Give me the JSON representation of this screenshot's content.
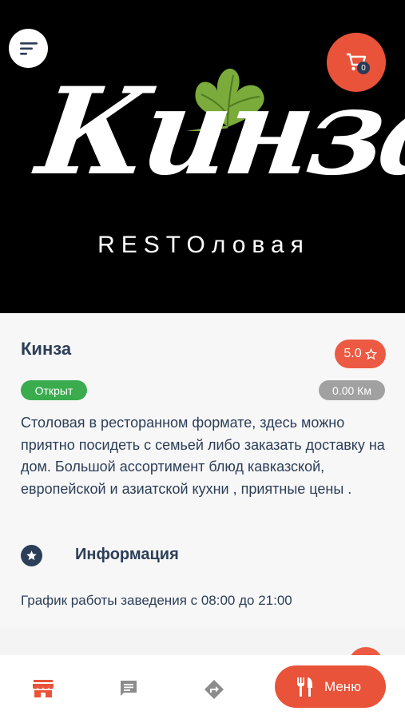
{
  "header": {
    "menu_icon": "sort-lines-icon",
    "cart_icon": "cart-icon",
    "cart_count": "0",
    "logo": {
      "script_text": "Кинза",
      "sub_text": "RESTOловая",
      "leaf_icon": "cilantro-leaf-icon"
    }
  },
  "restaurant": {
    "name": "Кинза",
    "rating": "5.0",
    "rating_icon": "star-outline-icon",
    "status": "Открыт",
    "distance": "0.00 Км",
    "description": "Столовая в ресторанном формате, здесь можно приятно посидеть с семьей либо заказать доставку на дом. Большой ассортимент блюд кавказской, европейской и азиатской кухни , приятные цены ."
  },
  "info": {
    "icon": "star-circle-icon",
    "title": "Информация",
    "hours": "График работы заведения с 08:00 до 21:00"
  },
  "bottom_nav": {
    "items": [
      {
        "icon": "store-icon",
        "active": true
      },
      {
        "icon": "chat-icon",
        "active": false
      },
      {
        "icon": "directions-icon",
        "active": false
      }
    ],
    "menu_label": "Меню",
    "menu_icon": "fork-knife-icon"
  },
  "colors": {
    "accent": "#e8533a",
    "status_open": "#3aac4e",
    "distance_badge": "#a1a1a1",
    "text_primary": "#2c3e58"
  }
}
